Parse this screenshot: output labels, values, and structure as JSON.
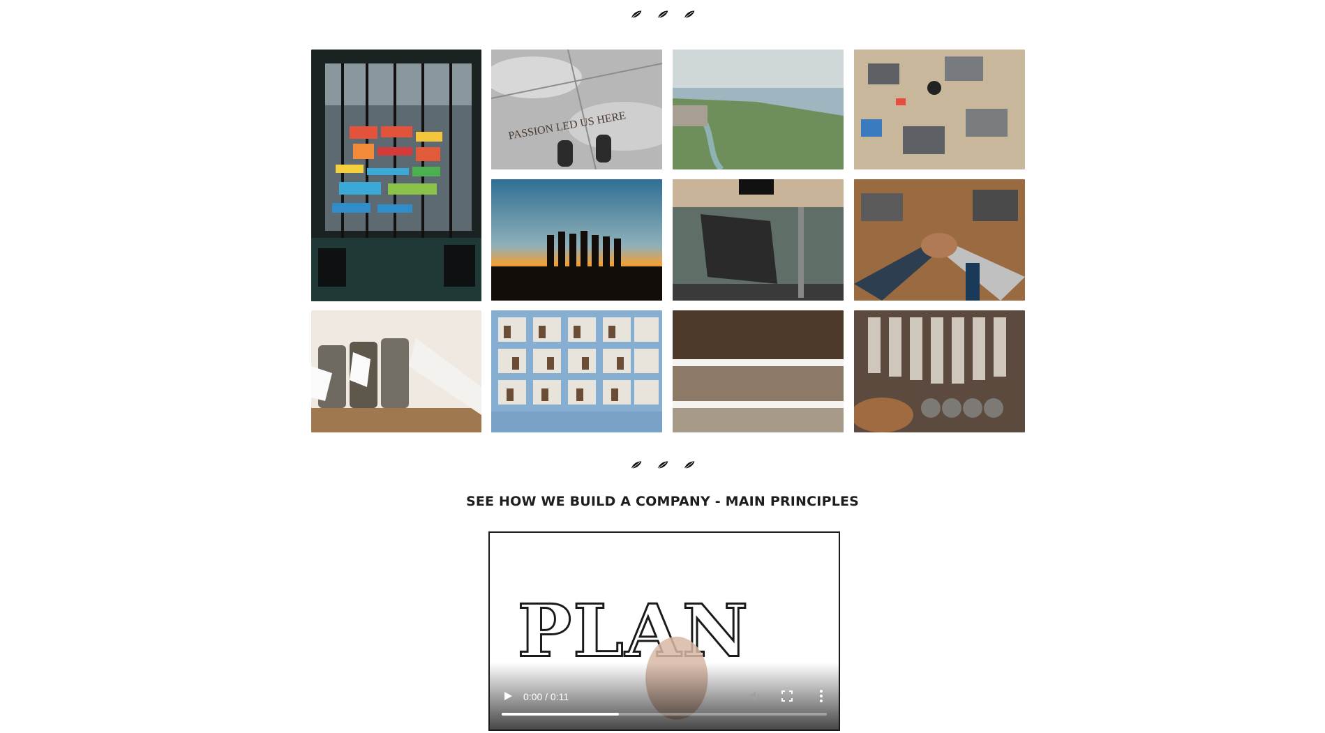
{
  "decor": {
    "leaf_count": 3,
    "leaf_icon": "leaf-icon"
  },
  "gallery": {
    "images": [
      {
        "name": "office-sticky-notes-photo",
        "palette": [
          "#1f2a2a",
          "#e25b3a",
          "#2f8ec9"
        ]
      },
      {
        "name": "passion-led-us-here-photo",
        "text": "PASSION LED US HERE"
      },
      {
        "name": "city-coastline-aerial-photo"
      },
      {
        "name": "desk-laptops-topdown-photo"
      },
      {
        "name": "team-sunset-silhouette-photo"
      },
      {
        "name": "office-desk-window-view-photo"
      },
      {
        "name": "team-fist-bump-photo"
      },
      {
        "name": "tea-jars-shelf-hand-photo"
      },
      {
        "name": "apothecary-blue-shelves-photo"
      },
      {
        "name": "spice-jars-shelves-photo"
      },
      {
        "name": "tea-dispensers-photo"
      }
    ]
  },
  "section": {
    "title": "SEE HOW WE BUILD A COMPANY - MAIN PRINCIPLES"
  },
  "video": {
    "poster_text": "PLAN",
    "time_display": "0:00 / 0:11",
    "progress_fraction": 0.36,
    "icons": {
      "play": "play-icon",
      "mute": "volume-icon",
      "fullscreen": "fullscreen-icon",
      "menu": "more-vert-icon"
    }
  }
}
